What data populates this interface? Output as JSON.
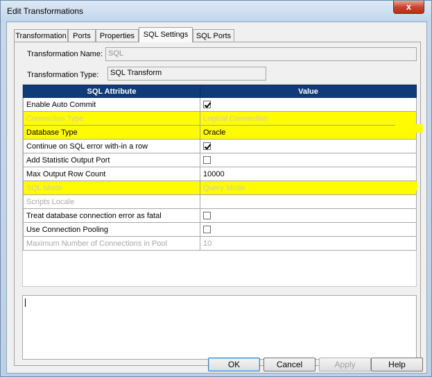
{
  "window": {
    "title": "Edit Transformations",
    "close_label": "x"
  },
  "tabs": [
    {
      "label": "Transformation",
      "active": false
    },
    {
      "label": "Ports",
      "active": false
    },
    {
      "label": "Properties",
      "active": false
    },
    {
      "label": "SQL Settings",
      "active": true
    },
    {
      "label": "SQL Ports",
      "active": false
    }
  ],
  "form": {
    "name_label": "Transformation Name:",
    "name_value": "SQL",
    "type_label": "Transformation Type:",
    "type_value": "SQL Transform"
  },
  "grid": {
    "headers": [
      "SQL Attribute",
      "Value"
    ],
    "rows": [
      {
        "attribute": "Enable Auto Commit",
        "value": "",
        "checkbox": true,
        "checked": true,
        "disabled": false,
        "highlighted": false
      },
      {
        "attribute": "Connection Type",
        "value": "Logical Connection",
        "checkbox": false,
        "disabled": true,
        "highlighted": true
      },
      {
        "attribute": "Database Type",
        "value": "Oracle",
        "checkbox": false,
        "disabled": false,
        "highlighted": true
      },
      {
        "attribute": "Continue on SQL error with-in a row",
        "value": "",
        "checkbox": true,
        "checked": true,
        "disabled": false,
        "highlighted": false
      },
      {
        "attribute": "Add Statistic Output Port",
        "value": "",
        "checkbox": true,
        "checked": false,
        "disabled": false,
        "highlighted": false
      },
      {
        "attribute": "Max Output Row Count",
        "value": "10000",
        "checkbox": false,
        "disabled": false,
        "highlighted": false
      },
      {
        "attribute": "SQL Mode",
        "value": "Query Mode",
        "checkbox": false,
        "disabled": true,
        "highlighted": true
      },
      {
        "attribute": "Scripts Locale",
        "value": "",
        "checkbox": false,
        "disabled": true,
        "highlighted": false
      },
      {
        "attribute": "Treat database connection error as fatal",
        "value": "",
        "checkbox": true,
        "checked": false,
        "disabled": false,
        "highlighted": false
      },
      {
        "attribute": "Use Connection Pooling",
        "value": "",
        "checkbox": true,
        "checked": false,
        "disabled": false,
        "highlighted": false
      },
      {
        "attribute": "Maximum Number of Connections in Pool",
        "value": "10",
        "checkbox": false,
        "disabled": true,
        "highlighted": false
      }
    ]
  },
  "notes": {
    "value": ""
  },
  "buttons": {
    "ok": "OK",
    "cancel": "Cancel",
    "apply": "Apply",
    "help": "Help"
  },
  "colors": {
    "header_bg": "#0f3b78",
    "highlight": "#fffb00"
  }
}
